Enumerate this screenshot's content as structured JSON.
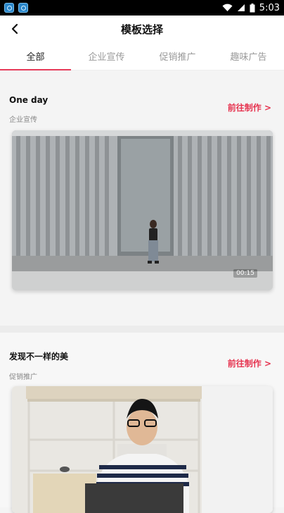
{
  "status": {
    "time": "5:03"
  },
  "header": {
    "title": "模板选择"
  },
  "tabs": [
    {
      "label": "全部",
      "active": true
    },
    {
      "label": "企业宣传",
      "active": false
    },
    {
      "label": "促销推广",
      "active": false
    },
    {
      "label": "趣味广告",
      "active": false
    }
  ],
  "templates": [
    {
      "title": "One day",
      "category": "企业宣传",
      "action": "前往制作 >",
      "duration": "00:15"
    },
    {
      "title": "发现不一样的美",
      "category": "促销推广",
      "action": "前往制作 >"
    }
  ],
  "colors": {
    "accent": "#e6334f",
    "tab_indicator": "#e63b5a"
  }
}
